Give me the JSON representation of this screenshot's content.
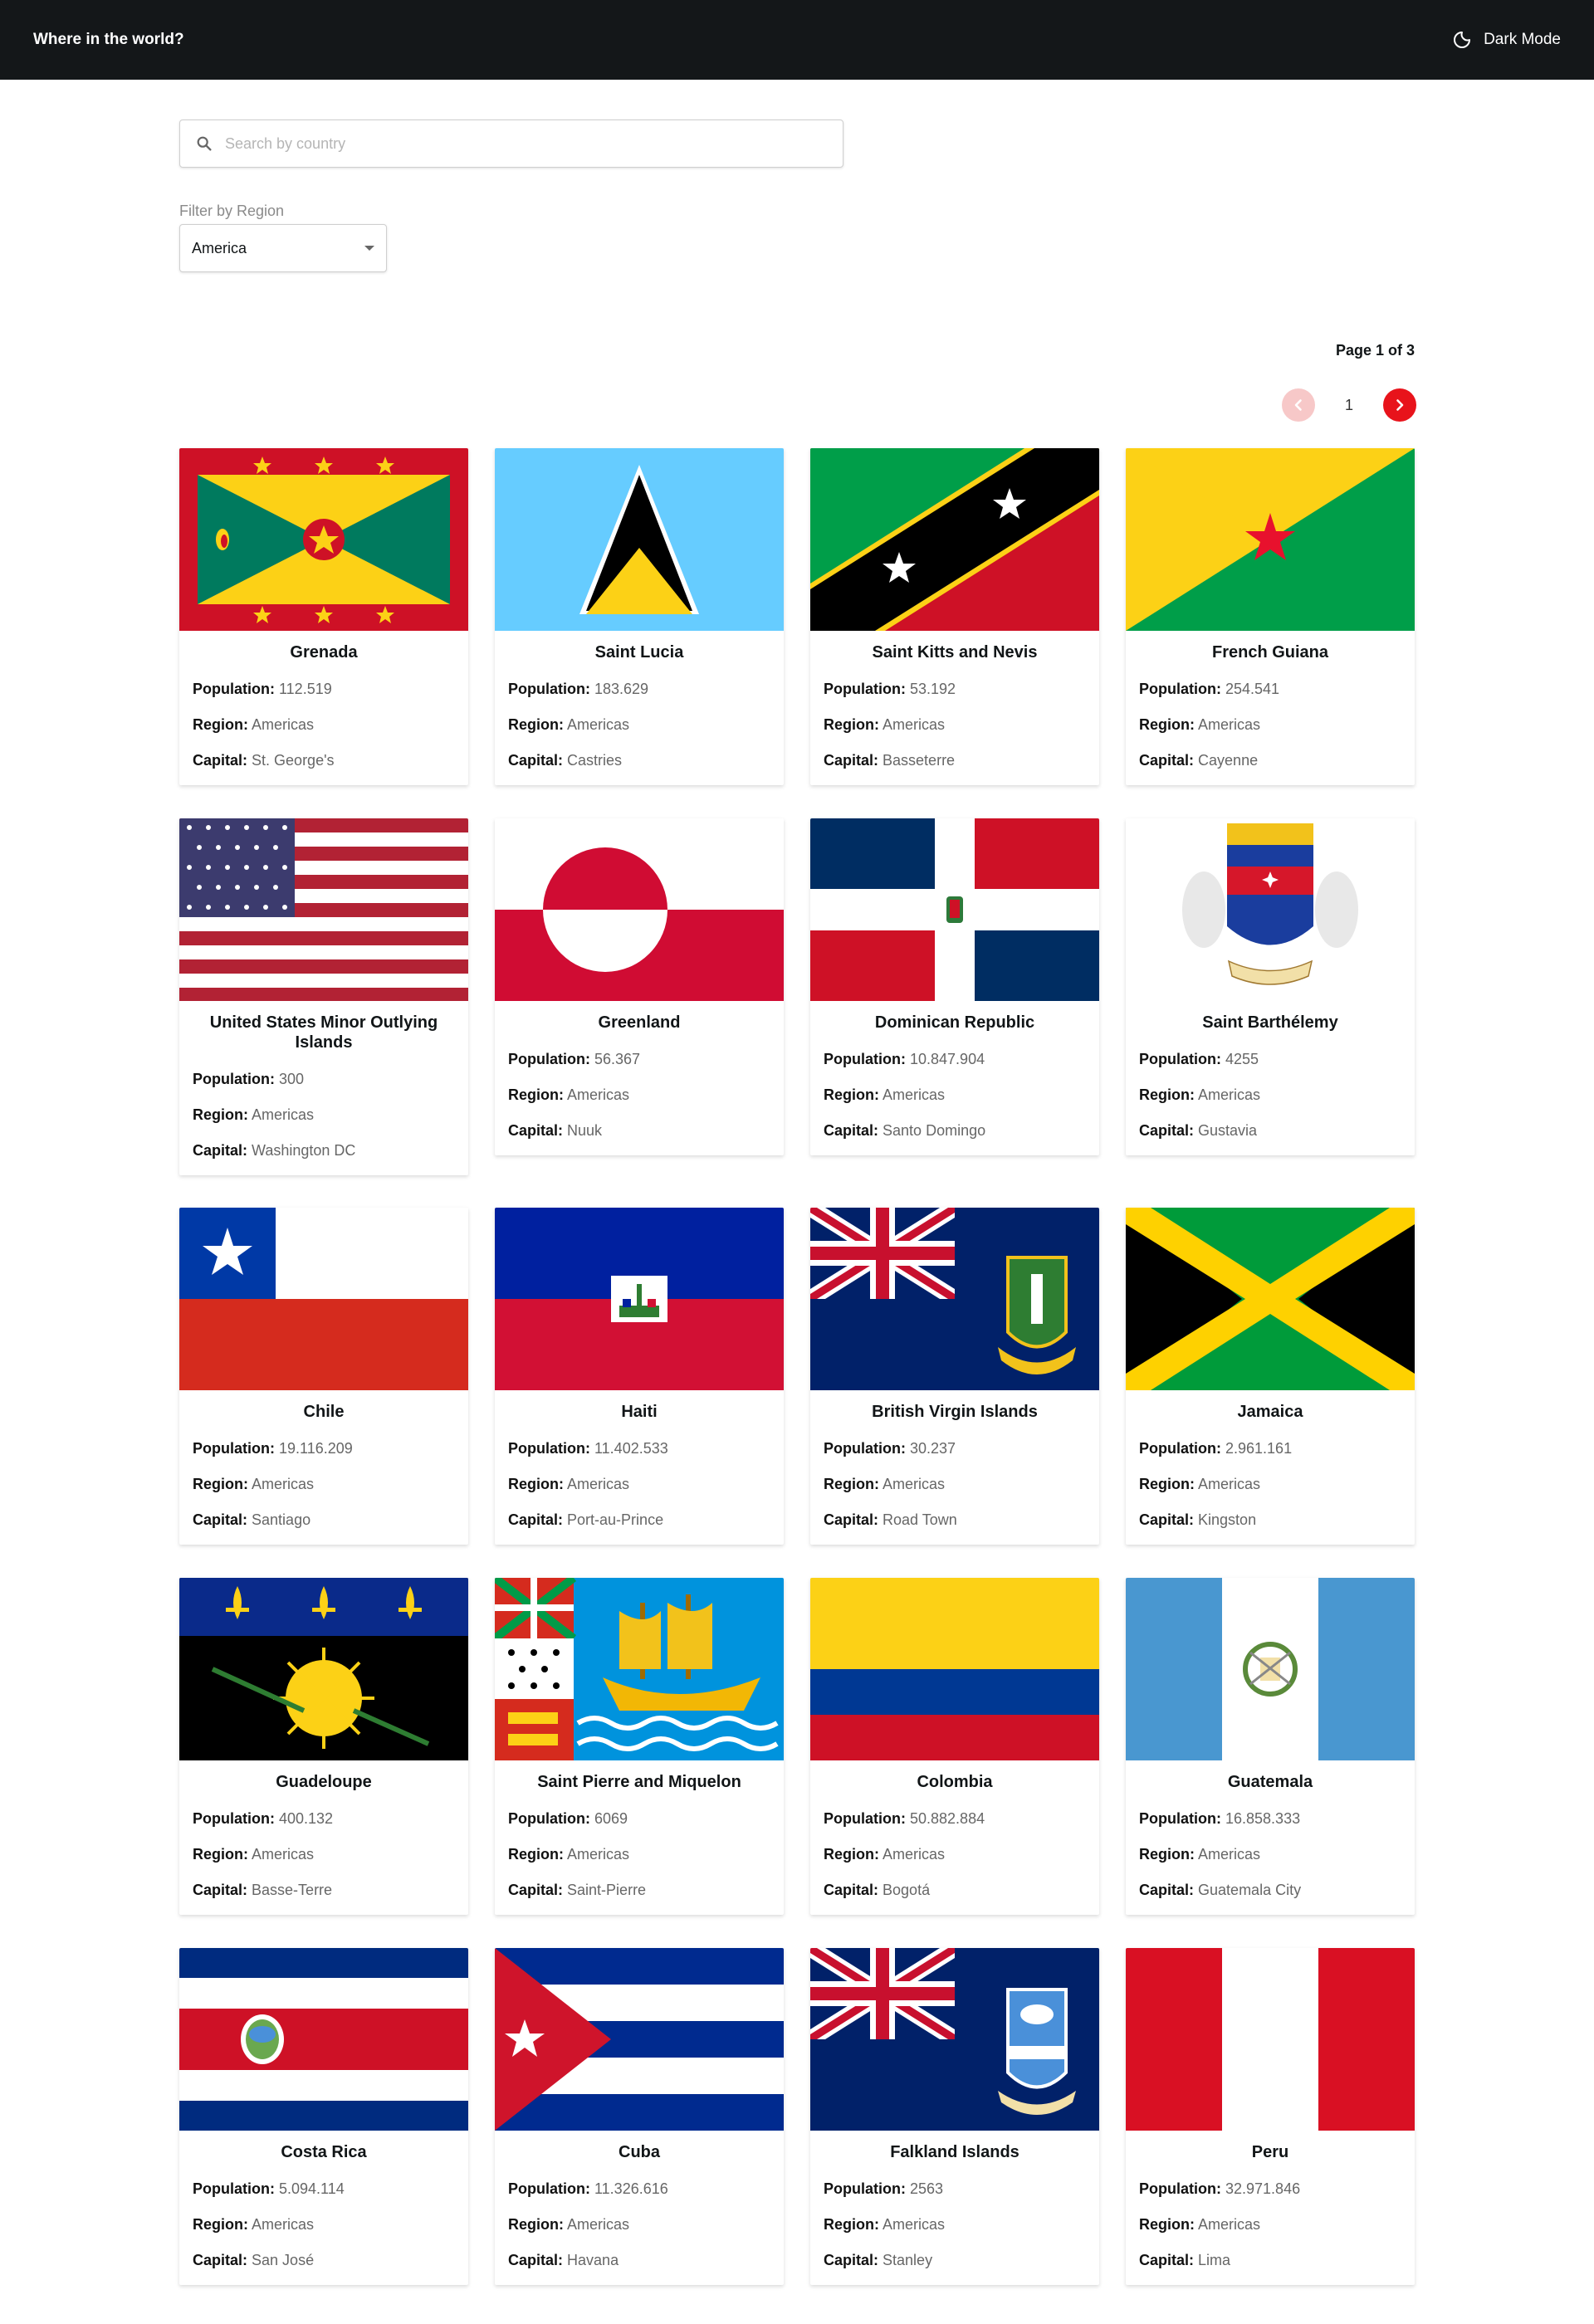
{
  "header": {
    "title": "Where in the world?",
    "mode_label": "Dark Mode"
  },
  "search": {
    "placeholder": "Search by country",
    "value": ""
  },
  "filter": {
    "label": "Filter by Region",
    "selected": "America"
  },
  "pagination": {
    "info": "Page 1 of 3",
    "current_page": "1"
  },
  "labels": {
    "population": "Population:",
    "region": "Region:",
    "capital": "Capital:"
  },
  "countries": [
    {
      "name": "Grenada",
      "population": "112.519",
      "region": "Americas",
      "capital": "St. George's"
    },
    {
      "name": "Saint Lucia",
      "population": "183.629",
      "region": "Americas",
      "capital": "Castries"
    },
    {
      "name": "Saint Kitts and Nevis",
      "population": "53.192",
      "region": "Americas",
      "capital": "Basseterre"
    },
    {
      "name": "French Guiana",
      "population": "254.541",
      "region": "Americas",
      "capital": "Cayenne"
    },
    {
      "name": "United States Minor Outlying Islands",
      "population": "300",
      "region": "Americas",
      "capital": "Washington DC"
    },
    {
      "name": "Greenland",
      "population": "56.367",
      "region": "Americas",
      "capital": "Nuuk"
    },
    {
      "name": "Dominican Republic",
      "population": "10.847.904",
      "region": "Americas",
      "capital": "Santo Domingo"
    },
    {
      "name": "Saint Barthélemy",
      "population": "4255",
      "region": "Americas",
      "capital": "Gustavia"
    },
    {
      "name": "Chile",
      "population": "19.116.209",
      "region": "Americas",
      "capital": "Santiago"
    },
    {
      "name": "Haiti",
      "population": "11.402.533",
      "region": "Americas",
      "capital": "Port-au-Prince"
    },
    {
      "name": "British Virgin Islands",
      "population": "30.237",
      "region": "Americas",
      "capital": "Road Town"
    },
    {
      "name": "Jamaica",
      "population": "2.961.161",
      "region": "Americas",
      "capital": "Kingston"
    },
    {
      "name": "Guadeloupe",
      "population": "400.132",
      "region": "Americas",
      "capital": "Basse-Terre"
    },
    {
      "name": "Saint Pierre and Miquelon",
      "population": "6069",
      "region": "Americas",
      "capital": "Saint-Pierre"
    },
    {
      "name": "Colombia",
      "population": "50.882.884",
      "region": "Americas",
      "capital": "Bogotá"
    },
    {
      "name": "Guatemala",
      "population": "16.858.333",
      "region": "Americas",
      "capital": "Guatemala City"
    },
    {
      "name": "Costa Rica",
      "population": "5.094.114",
      "region": "Americas",
      "capital": "San José"
    },
    {
      "name": "Cuba",
      "population": "11.326.616",
      "region": "Americas",
      "capital": "Havana"
    },
    {
      "name": "Falkland Islands",
      "population": "2563",
      "region": "Americas",
      "capital": "Stanley"
    },
    {
      "name": "Peru",
      "population": "32.971.846",
      "region": "Americas",
      "capital": "Lima"
    }
  ]
}
